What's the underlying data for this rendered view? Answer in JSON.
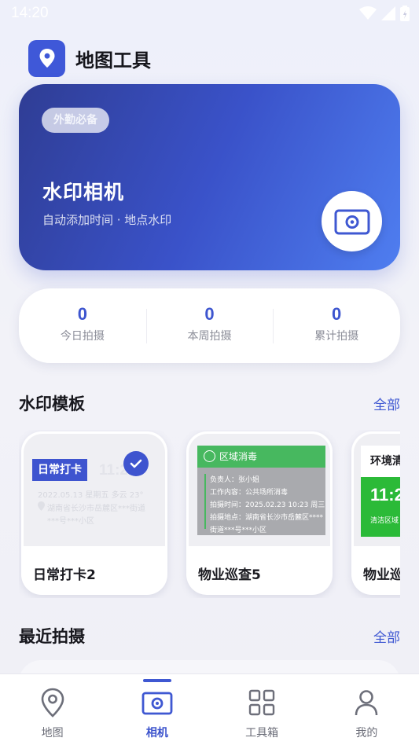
{
  "status_bar": {
    "time": "14:20"
  },
  "app": {
    "title": "地图工具"
  },
  "hero": {
    "badge": "外勤必备",
    "title": "水印相机",
    "subtitle": "自动添加时间 · 地点水印"
  },
  "stats": [
    {
      "value": "0",
      "label": "今日拍摄"
    },
    {
      "value": "0",
      "label": "本周拍摄"
    },
    {
      "value": "0",
      "label": "累计拍摄"
    }
  ],
  "templates_section": {
    "title": "水印模板",
    "more": "全部"
  },
  "templates": [
    {
      "name": "日常打卡2",
      "selected": true,
      "preview": {
        "tag": "日常打卡",
        "time": "11:2",
        "line1": "2022.05.13  星期五   多云 23°",
        "line2": "湖南省长沙市岳麓区***街道",
        "line3": "***号***小区"
      }
    },
    {
      "name": "物业巡查5",
      "selected": false,
      "preview": {
        "header": "区域消毒",
        "lines": [
          "负责人：张小姐",
          "工作内容：公共场所消毒",
          "拍摄时间：2025.02.23  10:23  周三",
          "拍摄地点：湖南省长沙市岳麓区****",
          "街道***号***小区"
        ]
      }
    },
    {
      "name": "物业巡",
      "selected": false,
      "preview": {
        "header": "环境清",
        "time": "11:2",
        "sub": "清洁区域"
      }
    }
  ],
  "recent_section": {
    "title": "最近拍摄",
    "more": "全部"
  },
  "tabbar": [
    {
      "label": "地图",
      "icon": "map-pin-icon",
      "active": false
    },
    {
      "label": "相机",
      "icon": "camera-icon",
      "active": true
    },
    {
      "label": "工具箱",
      "icon": "grid-icon",
      "active": false
    },
    {
      "label": "我的",
      "icon": "user-icon",
      "active": false
    }
  ],
  "colors": {
    "accent": "#3f58d2",
    "hero_start": "#2f3d94",
    "hero_end": "#4f7ef0",
    "green": "#47b85f"
  }
}
